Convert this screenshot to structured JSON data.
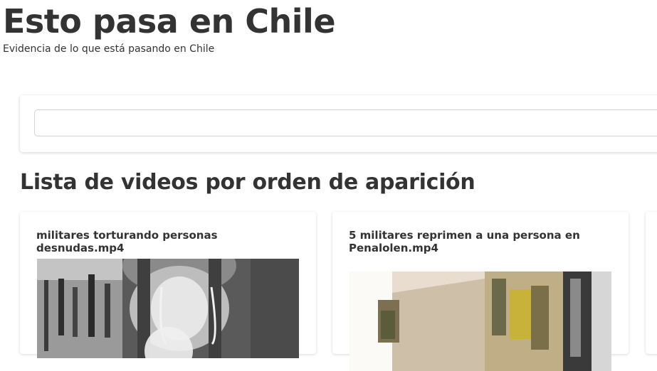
{
  "header": {
    "title": "Esto pasa en Chile",
    "subtitle": "Evidencia de lo que está pasando en Chile"
  },
  "search": {
    "value": "",
    "placeholder": ""
  },
  "section": {
    "heading": "Lista de videos por orden de aparición"
  },
  "videos": [
    {
      "title": "militares torturando personas desnudas.mp4"
    },
    {
      "title": "5 militares reprimen a una persona en Penalolen.mp4"
    }
  ]
}
